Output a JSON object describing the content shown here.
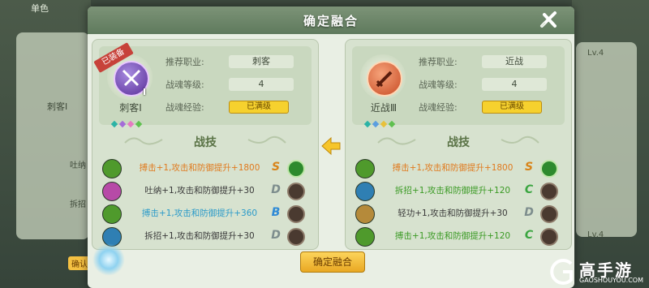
{
  "dialog": {
    "title": "确定融合",
    "confirm_label": "确定融合"
  },
  "labels": {
    "recommended_class": "推荐职业:",
    "soul_level": "战魂等级:",
    "soul_exp": "战魂经验:",
    "skills_title": "战技",
    "equipped": "已装备"
  },
  "left": {
    "name": "刺客Ⅰ",
    "roman": "Ⅰ",
    "class": "刺客",
    "level": "4",
    "exp": "已满级",
    "skills": [
      {
        "text": "搏击+1,攻击和防御提升+1800",
        "color": "#e07a1e",
        "icon": "#4f9a2c",
        "rank": "S",
        "rank_color": "#d8841a",
        "checked": true
      },
      {
        "text": "吐纳+1,攻击和防御提升+30",
        "color": "#3a3a3a",
        "icon": "#b74aa7",
        "rank": "D",
        "rank_color": "#7d8d8d",
        "checked": false
      },
      {
        "text": "搏击+1,攻击和防御提升+360",
        "color": "#2a9ac9",
        "icon": "#4f9a2c",
        "rank": "B",
        "rank_color": "#2f8ad6",
        "checked": false
      },
      {
        "text": "拆招+1,攻击和防御提升+30",
        "color": "#3a3a3a",
        "icon": "#2f7fb3",
        "rank": "D",
        "rank_color": "#7d8d8d",
        "checked": false
      }
    ]
  },
  "right": {
    "name": "近战Ⅲ",
    "class": "近战",
    "level": "4",
    "exp": "已满级",
    "skills": [
      {
        "text": "搏击+1,攻击和防御提升+1800",
        "color": "#e07a1e",
        "icon": "#4f9a2c",
        "rank": "S",
        "rank_color": "#d8841a",
        "checked": true
      },
      {
        "text": "拆招+1,攻击和防御提升+120",
        "color": "#3a9a24",
        "icon": "#2f7fb3",
        "rank": "C",
        "rank_color": "#3aa540",
        "checked": false
      },
      {
        "text": "轻功+1,攻击和防御提升+30",
        "color": "#3a3a3a",
        "icon": "#b58a3a",
        "rank": "D",
        "rank_color": "#7d8d8d",
        "checked": false
      },
      {
        "text": "搏击+1,攻击和防御提升+120",
        "color": "#3a9a24",
        "icon": "#4f9a2c",
        "rank": "C",
        "rank_color": "#3aa540",
        "checked": false
      }
    ]
  },
  "background": {
    "left_items": [
      "吐纳",
      "拆招",
      "确认"
    ],
    "lv_label": "Lv.4",
    "left_title": "单色",
    "left_card_name": "刺客Ⅰ"
  },
  "watermark": {
    "brand": "高手游",
    "url": "GAOSHOUYOU.COM"
  }
}
